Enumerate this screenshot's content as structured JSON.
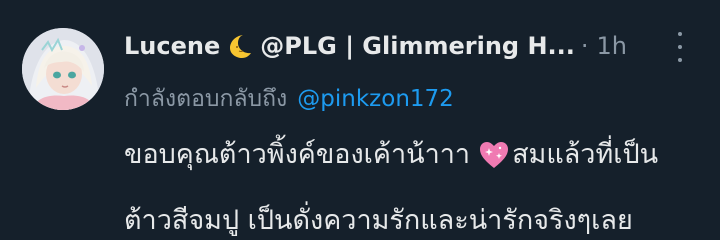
{
  "tweet": {
    "display_name": "Lucene",
    "moon_icon": "crescent-moon-emoji",
    "handle_text": "@PLG | Glimmering H...",
    "separator": "·",
    "time": "1h",
    "more_icon": "vertical-ellipsis-icon",
    "reply_prefix": "กำลังตอบกลับถึง",
    "reply_handle": "@pinkzon172",
    "body_line1_a": "ขอบคุณต้าวพิ้งค์ของเค้าน้าาา",
    "heart_icon": "sparkling-heart-emoji",
    "body_line1_b": "สมแล้วที่เป็น",
    "body_line2": "ต้าวสีจมปู เป็นดั่งความรักและน่ารักจริงๆเลย"
  },
  "colors": {
    "background": "#15202b",
    "primary_text": "#e7e9ea",
    "secondary_text": "#8b98a5",
    "link": "#1d9bf0"
  }
}
